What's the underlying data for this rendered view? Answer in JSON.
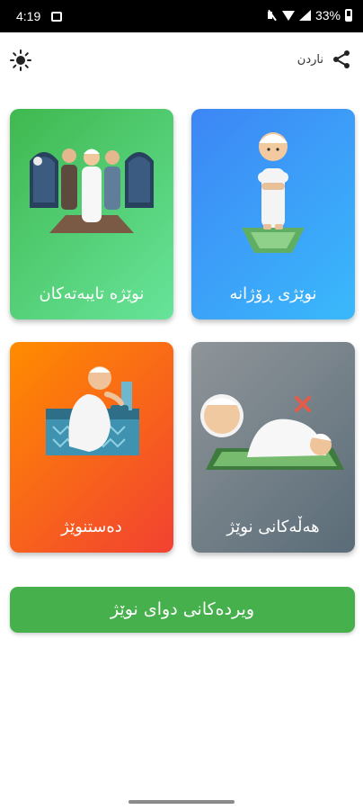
{
  "status_bar": {
    "time": "4:19",
    "battery_percent": "33%",
    "icons": [
      "gallery-icon",
      "mute-icon",
      "wifi-icon",
      "signal-icon",
      "battery-icon"
    ]
  },
  "toolbar": {
    "share_label": "ناردن",
    "left_icon": "brightness-icon",
    "right_icon": "share-icon"
  },
  "cards": {
    "daily_prayer": {
      "label": "نوێژی ڕۆژانە",
      "icon": "standing-prayer-illustration"
    },
    "special_prayers": {
      "label": "نوێژە تایبەتەکان",
      "icon": "group-prayer-illustration"
    },
    "prayer_mistakes": {
      "label": "هەڵەکانی نوێژ",
      "icon": "prostration-mistake-illustration"
    },
    "ablution": {
      "label": "دەستنوێژ",
      "icon": "ablution-illustration"
    }
  },
  "dhikr_button": {
    "label": "ویردەکانی دوای نوێژ"
  },
  "colors": {
    "daily": [
      "#3d86f5",
      "#3ab9fb"
    ],
    "special": [
      "#3fb84f",
      "#67e49a"
    ],
    "mistakes": [
      "#8f9599",
      "#5a6c78"
    ],
    "ablution": [
      "#ff8c00",
      "#f24132"
    ],
    "dhikr": "#46b04c"
  }
}
